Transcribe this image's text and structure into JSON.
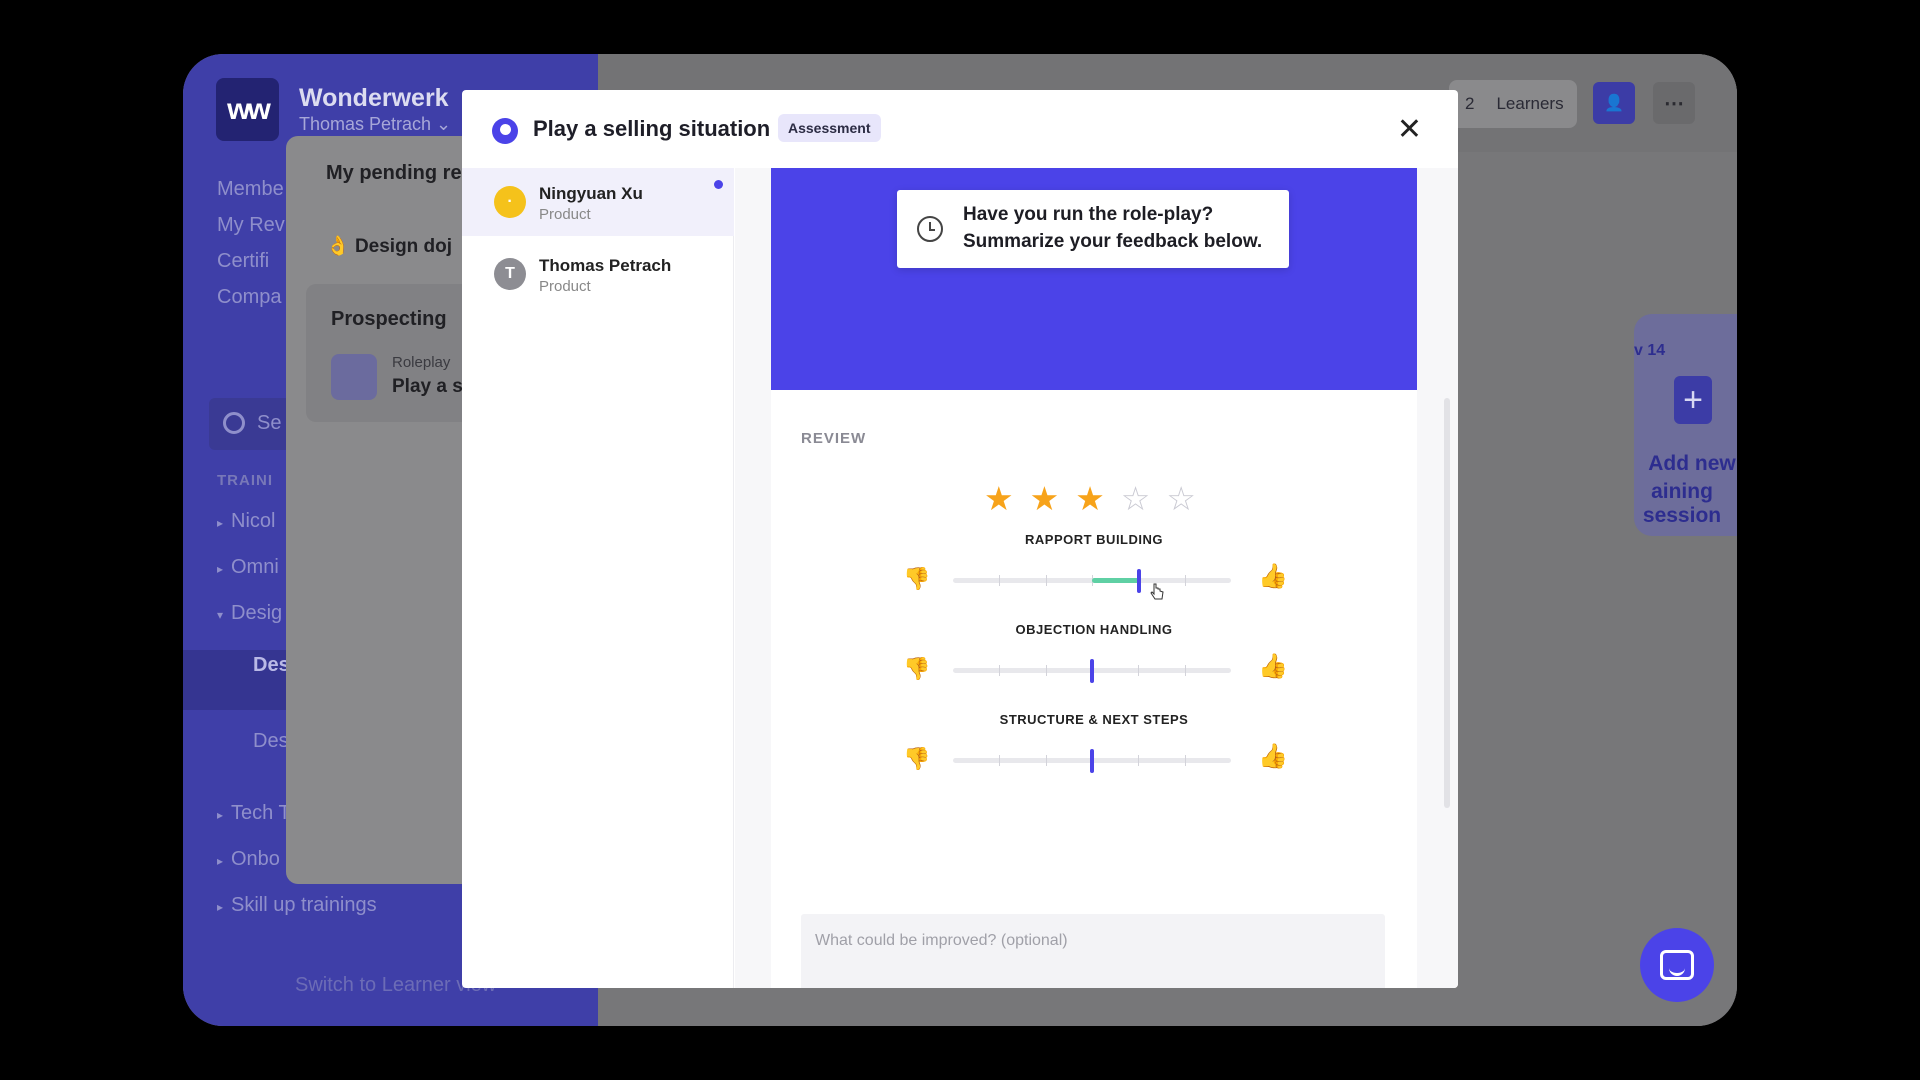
{
  "app": {
    "logo_text": "ww",
    "org_name": "Wonderwerk",
    "org_user": "Thomas Petrach ⌄",
    "nav": [
      "Membe",
      "My Rev",
      "Certifi",
      "Compa"
    ],
    "search_placeholder": "Se",
    "section_label": "TRAINI",
    "tree": [
      "Nicol",
      "Omni",
      "Desig",
      "Des",
      "Des",
      "Tech T",
      "Onbo",
      "Skill up trainings"
    ],
    "switch_view": "Switch to Learner view"
  },
  "top_bar": {
    "learners_count": "2",
    "learners_label": "Learners",
    "more_icon": "⋯"
  },
  "pending": {
    "title": "My pending re",
    "item1": "Design doj",
    "group_title": "Prospecting",
    "group_small": "Roleplay",
    "group_main": "Play a s"
  },
  "add_card": {
    "date": "v 14",
    "plus": "+",
    "line1": "Add new",
    "line2": "aining session"
  },
  "modal": {
    "title": "Play a selling situation",
    "badge": "Assessment",
    "close_icon": "✕",
    "learners": [
      {
        "initial": "·",
        "name": "Ningyuan Xu",
        "role": "Product",
        "color": "#f5c21b",
        "unread": true
      },
      {
        "initial": "T",
        "name": "Thomas Petrach",
        "role": "Product",
        "color": "#8d8d93",
        "unread": false
      }
    ],
    "banner": {
      "line1": "Have you run the role-play?",
      "line2": "Summarize your feedback below."
    },
    "review_label": "REVIEW",
    "rating": 3,
    "rating_max": 5,
    "criteria": [
      {
        "label": "RAPPORT BUILDING",
        "value": 0.67
      },
      {
        "label": "OBJECTION HANDLING",
        "value": 0.5
      },
      {
        "label": "STRUCTURE & NEXT STEPS",
        "value": 0.5
      }
    ],
    "improve_placeholder": "What could be improved? (optional)"
  },
  "colors": {
    "accent": "#4b43e8",
    "star_on": "#f7a31a",
    "slider_fill": "#5fd0a4"
  }
}
